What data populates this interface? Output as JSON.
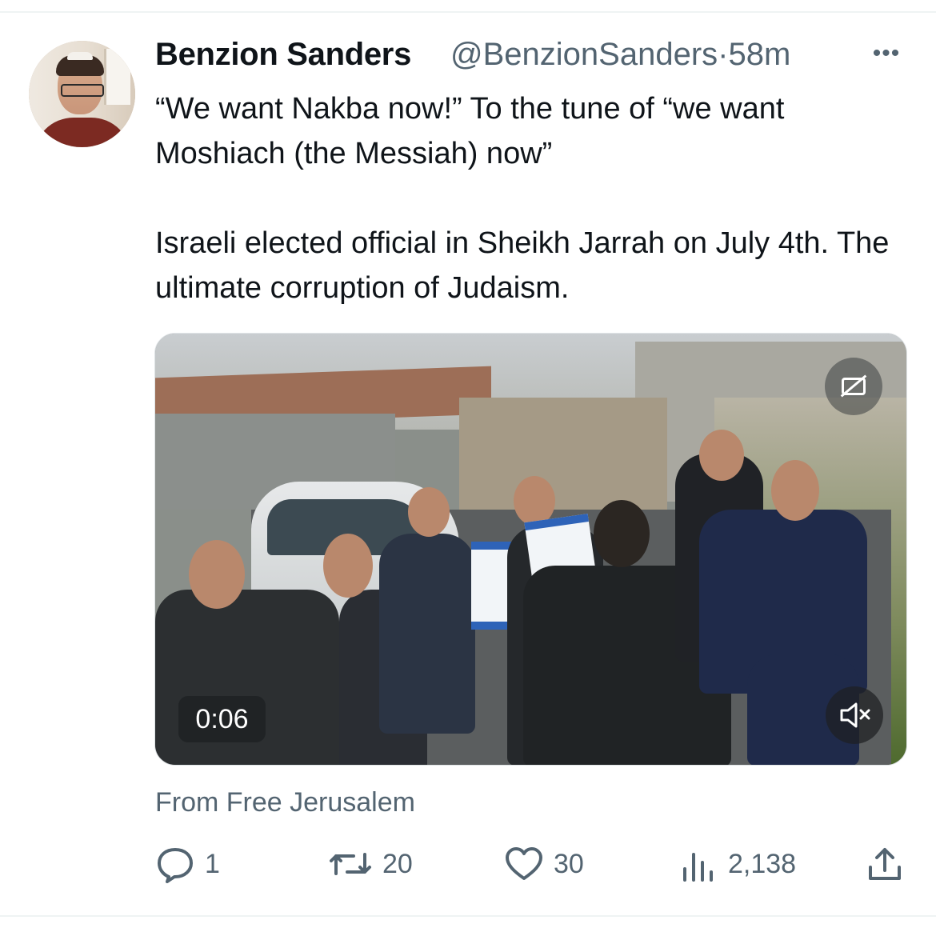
{
  "tweet": {
    "author_name": "Benzion Sanders",
    "handle": "@BenzionSanders",
    "separator": "·",
    "time": "58m",
    "more_label": "•••",
    "text": "“We want Nakba now!” To the tune of “we want Moshiach (the Messiah) now”\n\nIsraeli elected official in Sheikh Jarrah on July 4th. The ultimate corruption of Judaism."
  },
  "video": {
    "timestamp": "0:06",
    "captions_icon": "captions-off-icon",
    "mute_icon": "speaker-muted-icon"
  },
  "source": "From Free Jerusalem",
  "actions": {
    "reply_count": "1",
    "retweet_count": "20",
    "like_count": "30",
    "views_count": "2,138"
  },
  "colors": {
    "text_primary": "#0f1419",
    "text_secondary": "#536471",
    "divider": "#eff3f4"
  }
}
